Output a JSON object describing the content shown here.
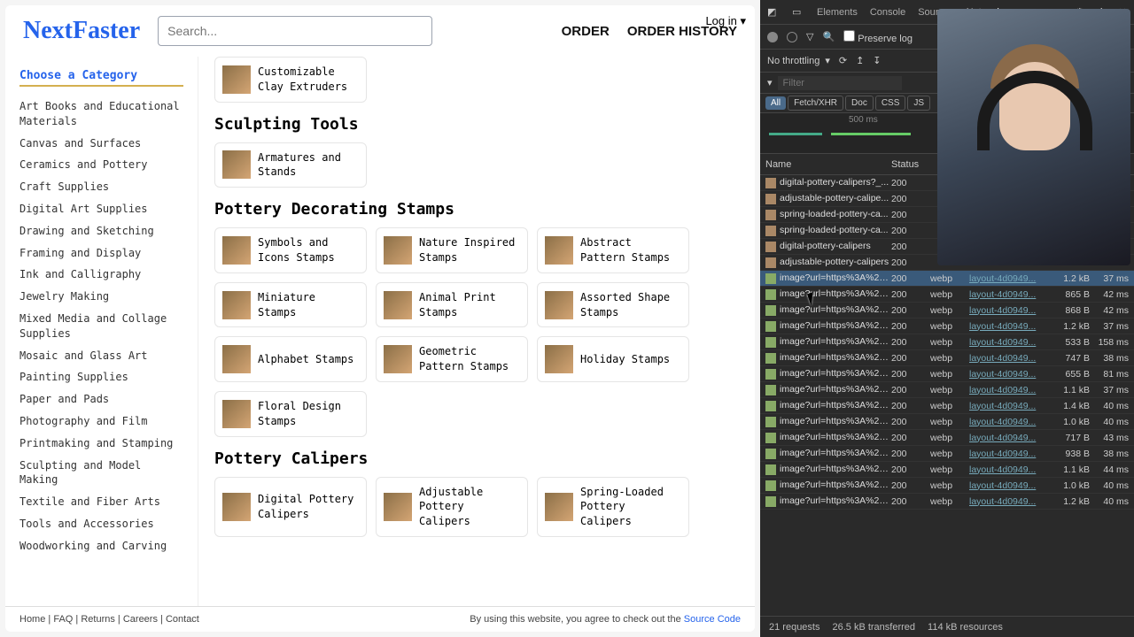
{
  "header": {
    "brand": "NextFaster",
    "search_placeholder": "Search...",
    "login": "Log in ▾",
    "order": "ORDER",
    "history": "ORDER HISTORY"
  },
  "sidebar": {
    "title": "Choose a Category",
    "items": [
      "Art Books and Educational Materials",
      "Canvas and Surfaces",
      "Ceramics and Pottery",
      "Craft Supplies",
      "Digital Art Supplies",
      "Drawing and Sketching",
      "Framing and Display",
      "Ink and Calligraphy",
      "Jewelry Making",
      "Mixed Media and Collage Supplies",
      "Mosaic and Glass Art",
      "Painting Supplies",
      "Paper and Pads",
      "Photography and Film",
      "Printmaking and Stamping",
      "Sculpting and Model Making",
      "Textile and Fiber Arts",
      "Tools and Accessories",
      "Woodworking and Carving"
    ]
  },
  "sections": [
    {
      "title": "",
      "items": [
        {
          "label": "Customizable Clay Extruders"
        }
      ]
    },
    {
      "title": "Sculpting Tools",
      "items": [
        {
          "label": "Armatures and Stands"
        }
      ]
    },
    {
      "title": "Pottery Decorating Stamps",
      "items": [
        {
          "label": "Symbols and Icons Stamps"
        },
        {
          "label": "Nature Inspired Stamps"
        },
        {
          "label": "Abstract Pattern Stamps"
        },
        {
          "label": "Miniature Stamps"
        },
        {
          "label": "Animal Print Stamps"
        },
        {
          "label": "Assorted Shape Stamps"
        },
        {
          "label": "Alphabet Stamps"
        },
        {
          "label": "Geometric Pattern Stamps"
        },
        {
          "label": "Holiday Stamps"
        },
        {
          "label": "Floral Design Stamps"
        }
      ]
    },
    {
      "title": "Pottery Calipers",
      "items": [
        {
          "label": "Digital Pottery Calipers"
        },
        {
          "label": "Adjustable Pottery Calipers"
        },
        {
          "label": "Spring-Loaded Pottery Calipers"
        }
      ]
    }
  ],
  "footer": {
    "links": [
      "Home",
      "FAQ",
      "Returns",
      "Careers",
      "Contact"
    ],
    "agree": "By using this website, you agree to check out the ",
    "source": "Source Code"
  },
  "devtools": {
    "tabs": [
      "Elements",
      "Console",
      "Sources",
      "Network"
    ],
    "preserve": "Preserve log",
    "throttling": "No throttling",
    "filter_placeholder": "Filter",
    "types": [
      "All",
      "Fetch/XHR",
      "Doc",
      "CSS",
      "JS"
    ],
    "timeline_label": "500 ms",
    "columns": [
      "Name",
      "Status",
      "",
      "",
      "",
      ""
    ],
    "col_status": "Status",
    "rows": [
      {
        "name": "digital-pottery-calipers?_...",
        "status": "200",
        "type": "",
        "init": "",
        "size": "",
        "time": "",
        "ico": "js"
      },
      {
        "name": "adjustable-pottery-calipe...",
        "status": "200",
        "type": "",
        "init": "",
        "size": "",
        "time": "",
        "ico": "js"
      },
      {
        "name": "spring-loaded-pottery-ca...",
        "status": "200",
        "type": "",
        "init": "",
        "size": "",
        "time": "",
        "ico": "js"
      },
      {
        "name": "spring-loaded-pottery-ca...",
        "status": "200",
        "type": "",
        "init": "",
        "size": "",
        "time": "",
        "ico": "js"
      },
      {
        "name": "digital-pottery-calipers",
        "status": "200",
        "type": "",
        "init": "",
        "size": "",
        "time": "",
        "ico": "js"
      },
      {
        "name": "adjustable-pottery-calipers",
        "status": "200",
        "type": "",
        "init": "",
        "size": "",
        "time": "",
        "ico": "js"
      },
      {
        "name": "image?url=https%3A%2F...",
        "status": "200",
        "type": "webp",
        "init": "layout-4d0949...",
        "size": "1.2 kB",
        "time": "37 ms",
        "ico": "img",
        "sel": true
      },
      {
        "name": "image?url=https%3A%2F...",
        "status": "200",
        "type": "webp",
        "init": "layout-4d0949...",
        "size": "865 B",
        "time": "42 ms",
        "ico": "img"
      },
      {
        "name": "image?url=https%3A%2F...",
        "status": "200",
        "type": "webp",
        "init": "layout-4d0949...",
        "size": "868 B",
        "time": "42 ms",
        "ico": "img"
      },
      {
        "name": "image?url=https%3A%2F...",
        "status": "200",
        "type": "webp",
        "init": "layout-4d0949...",
        "size": "1.2 kB",
        "time": "37 ms",
        "ico": "img"
      },
      {
        "name": "image?url=https%3A%2F...",
        "status": "200",
        "type": "webp",
        "init": "layout-4d0949...",
        "size": "533 B",
        "time": "158 ms",
        "ico": "img"
      },
      {
        "name": "image?url=https%3A%2F...",
        "status": "200",
        "type": "webp",
        "init": "layout-4d0949...",
        "size": "747 B",
        "time": "38 ms",
        "ico": "img"
      },
      {
        "name": "image?url=https%3A%2F...",
        "status": "200",
        "type": "webp",
        "init": "layout-4d0949...",
        "size": "655 B",
        "time": "81 ms",
        "ico": "img"
      },
      {
        "name": "image?url=https%3A%2F...",
        "status": "200",
        "type": "webp",
        "init": "layout-4d0949...",
        "size": "1.1 kB",
        "time": "37 ms",
        "ico": "img"
      },
      {
        "name": "image?url=https%3A%2F...",
        "status": "200",
        "type": "webp",
        "init": "layout-4d0949...",
        "size": "1.4 kB",
        "time": "40 ms",
        "ico": "img"
      },
      {
        "name": "image?url=https%3A%2F...",
        "status": "200",
        "type": "webp",
        "init": "layout-4d0949...",
        "size": "1.0 kB",
        "time": "40 ms",
        "ico": "img"
      },
      {
        "name": "image?url=https%3A%2F...",
        "status": "200",
        "type": "webp",
        "init": "layout-4d0949...",
        "size": "717 B",
        "time": "43 ms",
        "ico": "img"
      },
      {
        "name": "image?url=https%3A%2F...",
        "status": "200",
        "type": "webp",
        "init": "layout-4d0949...",
        "size": "938 B",
        "time": "38 ms",
        "ico": "img"
      },
      {
        "name": "image?url=https%3A%2F...",
        "status": "200",
        "type": "webp",
        "init": "layout-4d0949...",
        "size": "1.1 kB",
        "time": "44 ms",
        "ico": "img"
      },
      {
        "name": "image?url=https%3A%2F...",
        "status": "200",
        "type": "webp",
        "init": "layout-4d0949...",
        "size": "1.0 kB",
        "time": "40 ms",
        "ico": "img"
      },
      {
        "name": "image?url=https%3A%2F...",
        "status": "200",
        "type": "webp",
        "init": "layout-4d0949...",
        "size": "1.2 kB",
        "time": "40 ms",
        "ico": "img"
      }
    ],
    "status": {
      "requests": "21 requests",
      "transferred": "26.5 kB transferred",
      "resources": "114 kB resources"
    }
  }
}
